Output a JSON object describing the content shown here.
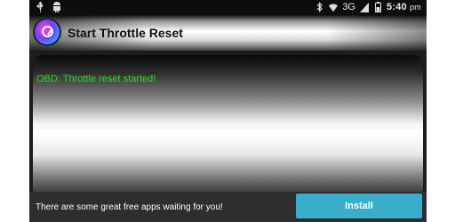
{
  "status_bar": {
    "left_icons": [
      "usb-icon",
      "android-debug-icon"
    ],
    "right_icons": [
      "bluetooth-icon",
      "wifi-icon",
      "signal-icon",
      "battery-icon"
    ],
    "network": "3G",
    "time": "5:40",
    "period": "pm"
  },
  "header": {
    "title": "Start Throttle Reset",
    "icon": "app-logo-icon"
  },
  "main": {
    "status_message": "OBD: Throttle reset started!",
    "status_color": "#22e022"
  },
  "ad": {
    "text": "There are some great free apps waiting for you!",
    "install_label": "Install",
    "button_color": "#39aecb"
  }
}
